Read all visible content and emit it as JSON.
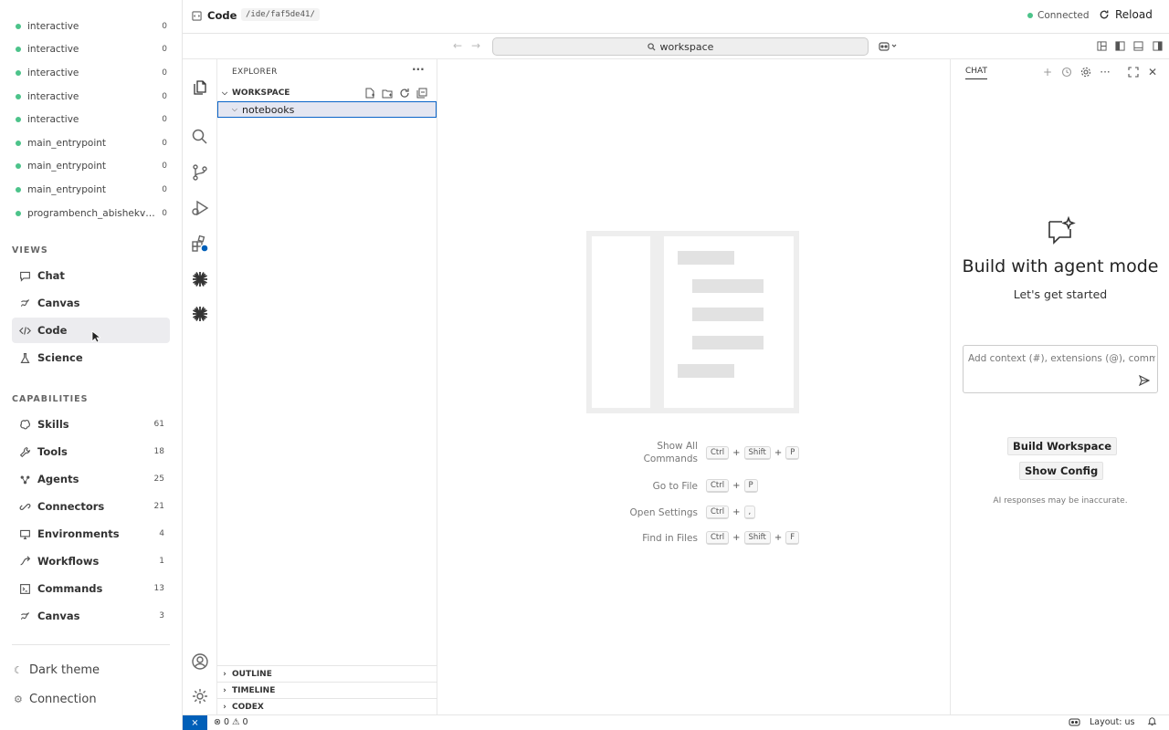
{
  "sidebar": {
    "sessions": [
      {
        "name": "interactive",
        "count": "0"
      },
      {
        "name": "interactive",
        "count": "0"
      },
      {
        "name": "interactive",
        "count": "0"
      },
      {
        "name": "interactive",
        "count": "0"
      },
      {
        "name": "interactive",
        "count": "0"
      },
      {
        "name": "main_entrypoint",
        "count": "0"
      },
      {
        "name": "main_entrypoint",
        "count": "0"
      },
      {
        "name": "main_entrypoint",
        "count": "0"
      },
      {
        "name": "programbench_abishekvas...",
        "count": "0"
      }
    ],
    "views_title": "VIEWS",
    "views": [
      {
        "label": "Chat",
        "icon": "chat-bubble-icon"
      },
      {
        "label": "Canvas",
        "icon": "canvas-icon"
      },
      {
        "label": "Code",
        "icon": "code-icon",
        "active": true
      },
      {
        "label": "Science",
        "icon": "flask-icon"
      }
    ],
    "capabilities_title": "CAPABILITIES",
    "capabilities": [
      {
        "label": "Skills",
        "count": "61",
        "icon": "brain-icon"
      },
      {
        "label": "Tools",
        "count": "18",
        "icon": "wrench-icon"
      },
      {
        "label": "Agents",
        "count": "25",
        "icon": "agent-icon"
      },
      {
        "label": "Connectors",
        "count": "21",
        "icon": "link-icon"
      },
      {
        "label": "Environments",
        "count": "4",
        "icon": "monitor-icon"
      },
      {
        "label": "Workflows",
        "count": "1",
        "icon": "workflow-icon"
      },
      {
        "label": "Commands",
        "count": "13",
        "icon": "terminal-icon"
      },
      {
        "label": "Canvas",
        "count": "3",
        "icon": "canvas-icon"
      }
    ],
    "dark_theme": "Dark theme",
    "connection": "Connection"
  },
  "topbar": {
    "title": "Code",
    "path": "/ide/faf5de41/",
    "status": "Connected",
    "status_color": "#4cc38a",
    "reload": "Reload"
  },
  "ide": {
    "search": "workspace",
    "explorer_title": "EXPLORER",
    "workspace_label": "WORKSPACE",
    "folder": "notebooks",
    "panes": [
      "OUTLINE",
      "TIMELINE",
      "CODEX"
    ],
    "shortcuts": [
      {
        "label": "Show All Commands",
        "keys": [
          "Ctrl",
          "Shift",
          "P"
        ]
      },
      {
        "label": "Go to File",
        "keys": [
          "Ctrl",
          "P"
        ]
      },
      {
        "label": "Open Settings",
        "keys": [
          "Ctrl",
          ","
        ]
      },
      {
        "label": "Find in Files",
        "keys": [
          "Ctrl",
          "Shift",
          "F"
        ]
      }
    ],
    "chat": {
      "tab": "CHAT",
      "heading": "Build with agent mode",
      "subheading": "Let's get started",
      "placeholder": "Add context (#), extensions (@), commands",
      "build_button": "Build Workspace",
      "config_button": "Show Config",
      "disclaimer": "AI responses may be inaccurate."
    },
    "statusbar": {
      "errors": "0",
      "warnings": "0",
      "layout": "Layout: us"
    },
    "accent": "#005fb8"
  }
}
